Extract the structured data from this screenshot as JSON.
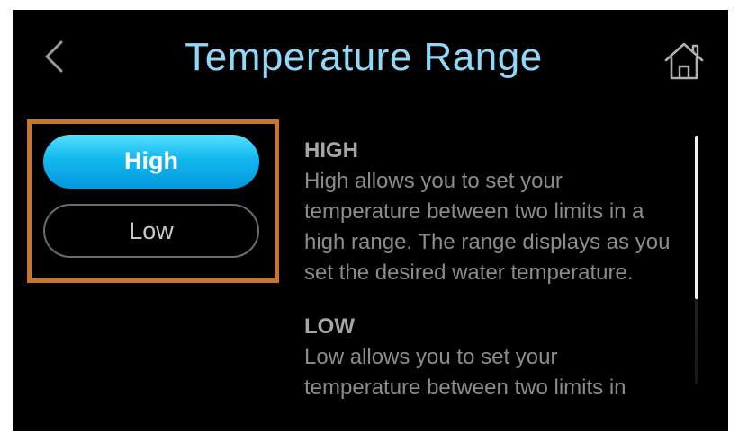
{
  "header": {
    "title": "Temperature Range",
    "back_icon": "chevron-left-icon",
    "home_icon": "home-icon"
  },
  "options": {
    "high_label": "High",
    "low_label": "Low",
    "selected": "High"
  },
  "descriptions": [
    {
      "heading": "HIGH",
      "body": "High allows you to set your temperature between two limits in a high range. The range displays as you set the desired water temperature."
    },
    {
      "heading": "LOW",
      "body": "Low allows you to set your temperature between two limits in"
    }
  ],
  "colors": {
    "title": "#8fd8f8",
    "selected_button": "#12b8ef",
    "highlight_border": "#c8762e",
    "description_text": "#8c8c8c"
  },
  "scroll": {
    "position_fraction": 0.0,
    "visible_fraction": 0.66
  }
}
